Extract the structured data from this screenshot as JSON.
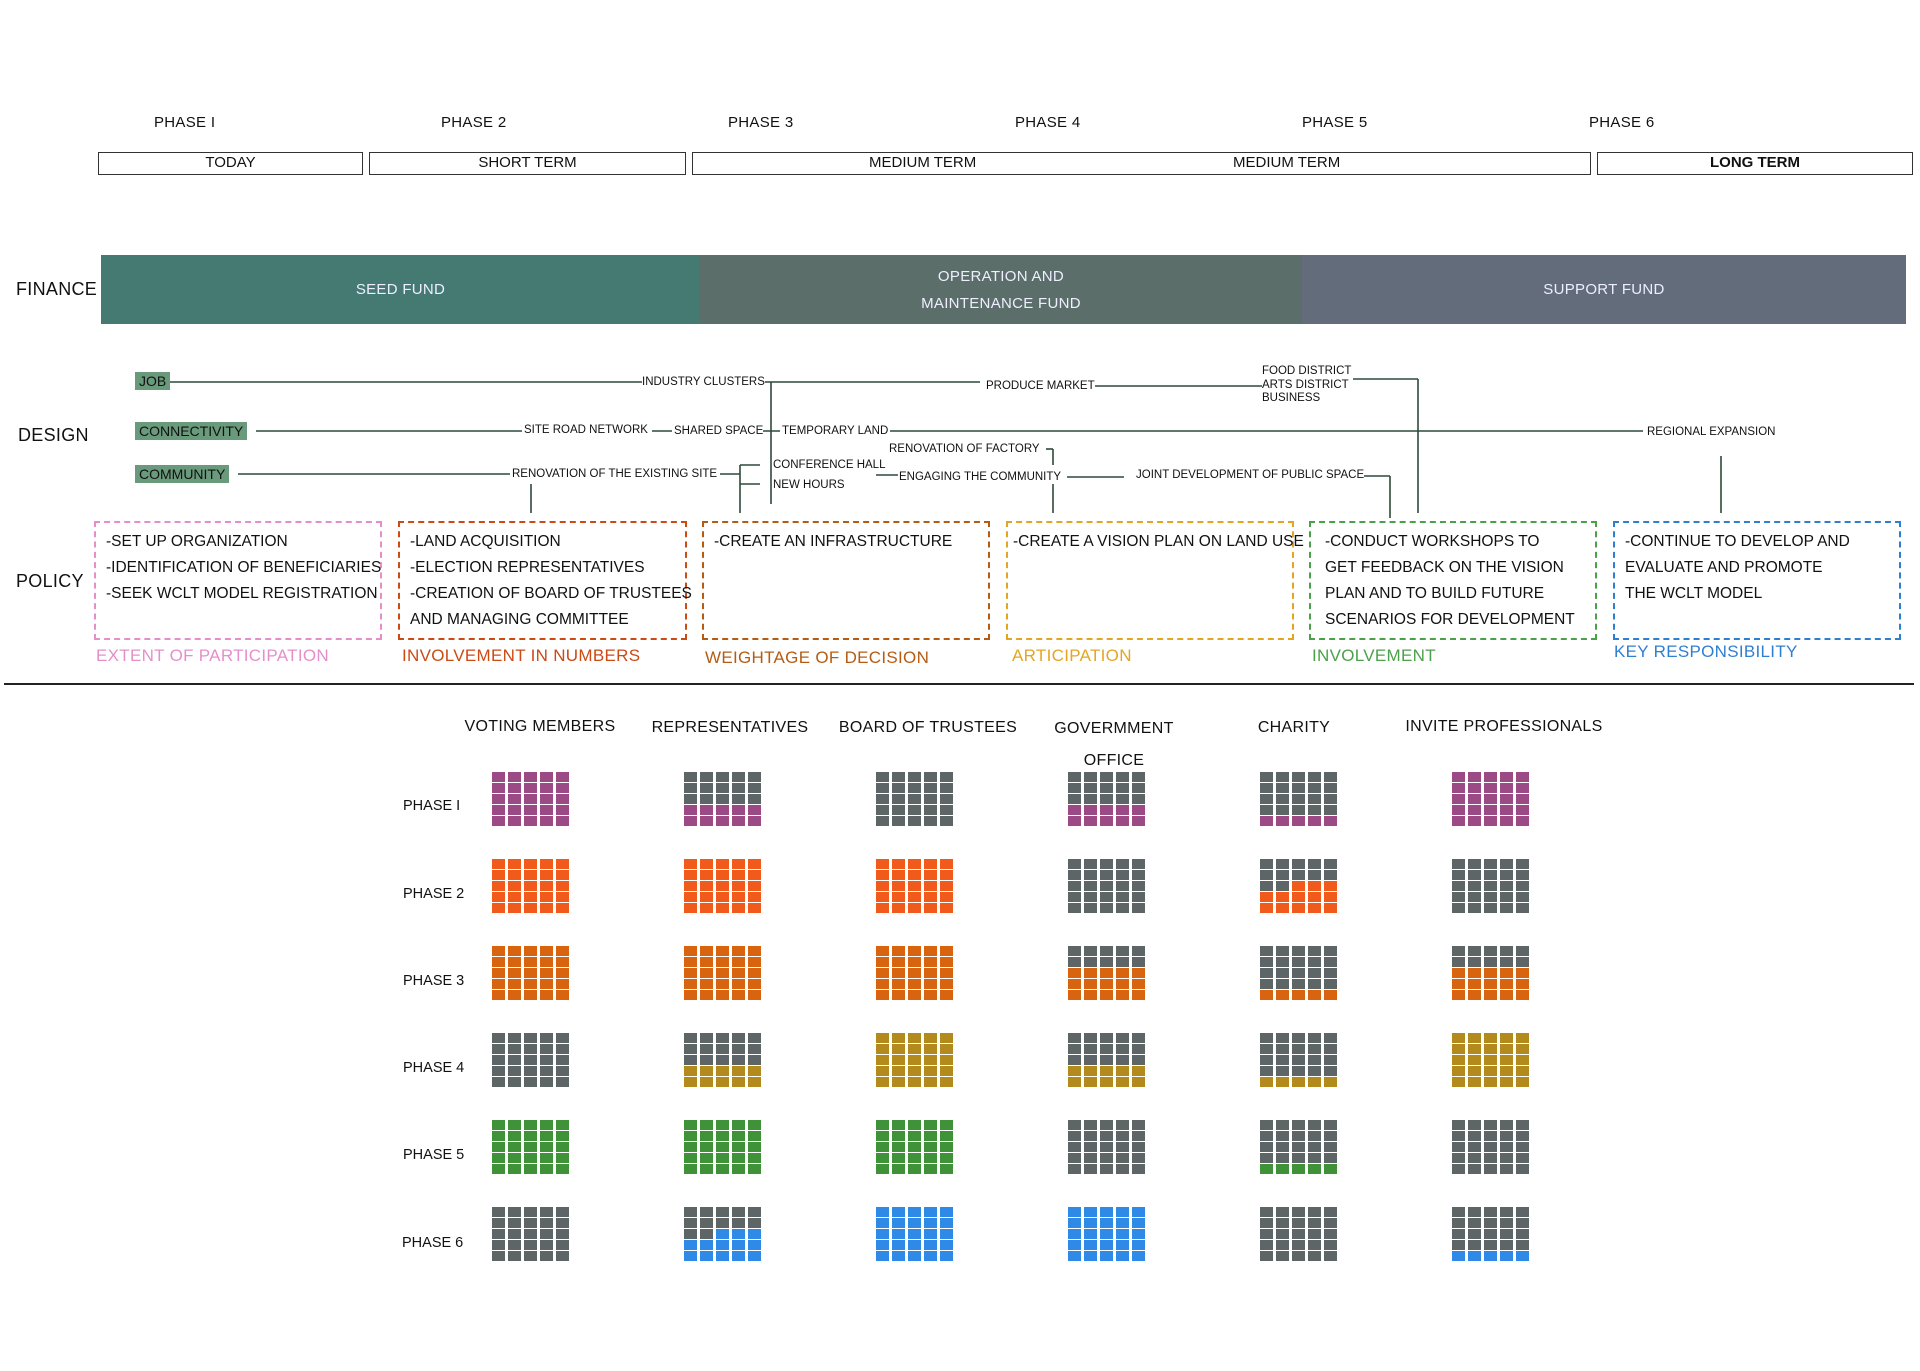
{
  "timeline": {
    "phases": [
      "PHASE I",
      "PHASE 2",
      "PHASE 3",
      "PHASE 4",
      "PHASE 5",
      "PHASE 6"
    ],
    "terms": [
      "TODAY",
      "SHORT TERM",
      "MEDIUM TERM",
      "MEDIUM TERM",
      "LONG TERM"
    ]
  },
  "rows": {
    "finance": "FINANCE",
    "design": "DESIGN",
    "policy": "POLICY"
  },
  "finance": {
    "segments": [
      {
        "line1": "SEED FUND",
        "line2": "",
        "color": "#457a73"
      },
      {
        "line1": "OPERATION AND",
        "line2": "MAINTENANCE FUND",
        "color": "#5b6e6a"
      },
      {
        "line1": "SUPPORT FUND",
        "line2": "",
        "color": "#626c7a"
      }
    ]
  },
  "design": {
    "tags": [
      "JOB",
      "CONNECTIVITY",
      "COMMUNITY"
    ],
    "tag_color": "#6a9a7c",
    "line_color": "#2f4a3a",
    "nodes": {
      "industry_clusters": "INDUSTRY CLUSTERS",
      "produce_market": "PRODUCE MARKET",
      "food_district": "FOOD DISTRICT",
      "arts_district": "ARTS DISTRICT",
      "business": "BUSINESS",
      "site_road_network": "SITE ROAD NETWORK",
      "shared_space": "SHARED SPACE",
      "temporary_land": "TEMPORARY LAND",
      "regional_expansion": "REGIONAL EXPANSION",
      "renovation_factory": "RENOVATION OF FACTORY",
      "conference_hall": "CONFERENCE HALL",
      "new_hours": "NEW HOURS",
      "renovation_existing": "RENOVATION OF THE EXISTING SITE",
      "engaging_community": "ENGAGING THE COMMUNITY",
      "joint_development": "JOINT DEVELOPMENT OF PUBLIC SPACE"
    }
  },
  "policy": {
    "boxes": [
      {
        "lines": [
          "-SET UP ORGANIZATION",
          "-IDENTIFICATION OF BENEFICIARIES",
          "-SEEK WCLT MODEL REGISTRATION"
        ],
        "caption": "EXTENT OF PARTICIPATION",
        "color": "#e58fca"
      },
      {
        "lines": [
          "-LAND ACQUISITION",
          "-ELECTION  REPRESENTATIVES",
          "-CREATION OF BOARD OF TRUSTEES",
          " AND MANAGING COMMITTEE"
        ],
        "caption": "INVOLVEMENT IN NUMBERS",
        "color": "#cc4a14"
      },
      {
        "lines": [
          "-CREATE AN INFRASTRUCTURE"
        ],
        "caption": "WEIGHTAGE OF DECISION",
        "color": "#b65c12"
      },
      {
        "lines": [
          "-CREATE A VISION PLAN ON LAND USE"
        ],
        "caption": "ARTICIPATION",
        "color": "#e3a623"
      },
      {
        "lines": [
          "-CONDUCT  WORKSHOPS TO",
          "GET FEEDBACK ON THE VISION",
          "PLAN AND TO BUILD FUTURE",
          "SCENARIOS FOR  DEVELOPMENT"
        ],
        "caption": "INVOLVEMENT",
        "color": "#4ba04a"
      },
      {
        "lines": [
          "-CONTINUE TO DEVELOP AND",
          "EVALUATE AND PROMOTE",
          "THE WCLT MODEL"
        ],
        "caption": "KEY RESPONSIBILITY",
        "color": "#2f7fd1"
      }
    ]
  },
  "matrix": {
    "columns": [
      {
        "line1": "VOTING MEMBERS",
        "line2": ""
      },
      {
        "line1": "REPRESENTATIVES",
        "line2": ""
      },
      {
        "line1": "BOARD OF TRUSTEES",
        "line2": ""
      },
      {
        "line1": "GOVERMMENT",
        "line2": "OFFICE"
      },
      {
        "line1": "CHARITY",
        "line2": ""
      },
      {
        "line1": "INVITE PROFESSIONALS",
        "line2": ""
      }
    ],
    "phase_labels": [
      "PHASE I",
      "PHASE 2",
      "PHASE 3",
      "PHASE 4",
      "PHASE 5",
      "PHASE 6"
    ],
    "empty_color": "#5d6567",
    "phase_colors": [
      "#9b4a86",
      "#f25a1c",
      "#d9640f",
      "#b38a1c",
      "#3f9237",
      "#2e8ae6"
    ],
    "filled_cells_of_25": [
      [
        25,
        10,
        0,
        10,
        5,
        25
      ],
      [
        25,
        25,
        25,
        0,
        13,
        0
      ],
      [
        25,
        25,
        25,
        15,
        5,
        15
      ],
      [
        0,
        10,
        25,
        10,
        5,
        25
      ],
      [
        25,
        25,
        25,
        0,
        5,
        0
      ],
      [
        0,
        13,
        25,
        25,
        0,
        5
      ]
    ]
  }
}
